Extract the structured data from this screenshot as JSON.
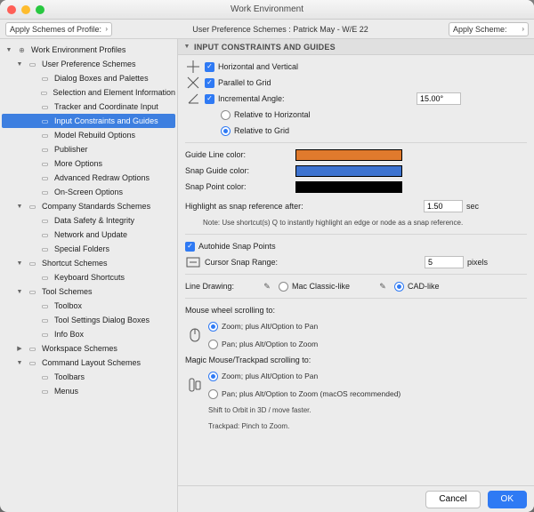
{
  "window": {
    "title": "Work Environment"
  },
  "toolbar": {
    "left_combo": "Apply Schemes of Profile:",
    "crumb": "User Preference Schemes :  Patrick May - W/E 22",
    "right_combo": "Apply Scheme:"
  },
  "tree": {
    "root": "Work Environment Profiles",
    "ups": "User Preference Schemes",
    "ups_items": [
      "Dialog Boxes and Palettes",
      "Selection and Element Information",
      "Tracker and Coordinate Input",
      "Input Constraints and Guides",
      "Model Rebuild Options",
      "Publisher",
      "More Options",
      "Advanced Redraw Options",
      "On-Screen Options"
    ],
    "css": "Company Standards Schemes",
    "css_items": [
      "Data Safety & Integrity",
      "Network and Update",
      "Special Folders"
    ],
    "ss": "Shortcut Schemes",
    "ss_items": [
      "Keyboard Shortcuts"
    ],
    "ts": "Tool Schemes",
    "ts_items": [
      "Toolbox",
      "Tool Settings Dialog Boxes",
      "Info Box"
    ],
    "ws": "Workspace Schemes",
    "cls": "Command Layout Schemes",
    "cls_items": [
      "Toolbars",
      "Menus"
    ]
  },
  "section": {
    "title": "INPUT CONSTRAINTS AND GUIDES"
  },
  "opts": {
    "hv": "Horizontal and Vertical",
    "pg": "Parallel to Grid",
    "ia": "Incremental Angle:",
    "ia_val": "15.00°",
    "rel_h": "Relative to Horizontal",
    "rel_g": "Relative to Grid",
    "glc": "Guide Line color:",
    "sgc": "Snap Guide color:",
    "spc": "Snap Point color:",
    "hsr": "Highlight as snap reference after:",
    "hsr_val": "1.50",
    "hsr_unit": "sec",
    "note_q": "Note: Use shortcut(s) Q to instantly highlight an edge or node as a snap reference.",
    "asp": "Autohide Snap Points",
    "csr": "Cursor Snap Range:",
    "csr_val": "5",
    "csr_unit": "pixels",
    "ld": "Line Drawing:",
    "ld_mac": "Mac Classic-like",
    "ld_cad": "CAD-like",
    "mws": "Mouse wheel scrolling to:",
    "mws_a": "Zoom; plus Alt/Option to Pan",
    "mws_b": "Pan; plus Alt/Option to Zoom",
    "mts": "Magic Mouse/Trackpad scrolling to:",
    "mts_a": "Zoom; plus Alt/Option to Pan",
    "mts_b": "Pan; plus Alt/Option to Zoom (macOS recommended)",
    "mts_note1": "Shift to Orbit in 3D / move faster.",
    "mts_note2": "Trackpad: Pinch to Zoom."
  },
  "footer": {
    "cancel": "Cancel",
    "ok": "OK"
  }
}
